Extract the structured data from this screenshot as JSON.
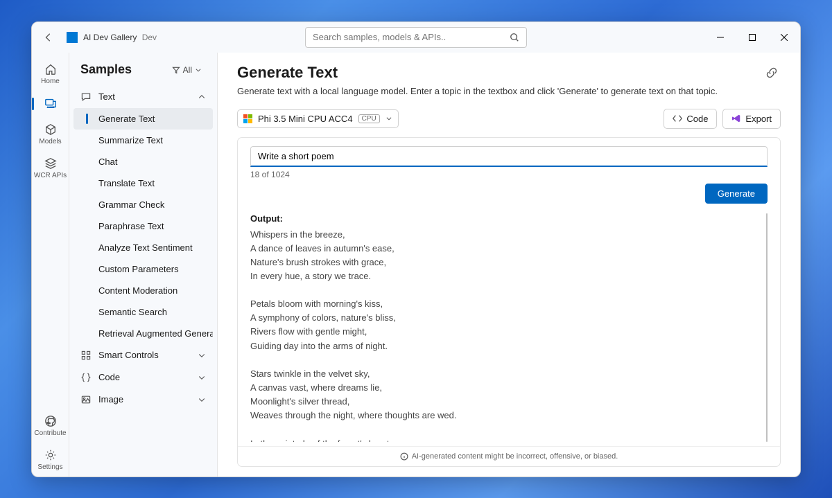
{
  "app": {
    "title": "AI Dev Gallery",
    "tag": "Dev"
  },
  "search": {
    "placeholder": "Search samples, models & APIs.."
  },
  "rail": {
    "home": "Home",
    "samples": "",
    "models": "Models",
    "wcr": "WCR APIs",
    "contribute": "Contribute",
    "settings": "Settings"
  },
  "sidebar": {
    "title": "Samples",
    "filter_label": "All",
    "categories": {
      "text": "Text",
      "smart": "Smart Controls",
      "code": "Code",
      "image": "Image"
    },
    "text_items": [
      "Generate Text",
      "Summarize Text",
      "Chat",
      "Translate Text",
      "Grammar Check",
      "Paraphrase Text",
      "Analyze Text Sentiment",
      "Custom Parameters",
      "Content Moderation",
      "Semantic Search",
      "Retrieval Augmented Genera"
    ]
  },
  "page": {
    "title": "Generate Text",
    "description": "Generate text with a local language model. Enter a topic in the textbox and click 'Generate' to generate text on that topic."
  },
  "model": {
    "name": "Phi 3.5 Mini CPU ACC4",
    "badge": "CPU"
  },
  "buttons": {
    "code": "Code",
    "export": "Export",
    "generate": "Generate"
  },
  "prompt": {
    "value": "Write a short poem",
    "count": "18 of 1024"
  },
  "output": {
    "label": "Output:",
    "text": "Whispers in the breeze,\nA dance of leaves in autumn's ease,\nNature's brush strokes with grace,\nIn every hue, a story we trace.\n\nPetals bloom with morning's kiss,\nA symphony of colors, nature's bliss,\nRivers flow with gentle might,\nGuiding day into the arms of night.\n\nStars twinkle in the velvet sky,\nA canvas vast, where dreams lie,\nMoonlight's silver thread,\nWeaves through the night, where thoughts are wed.\n\nIn the quietude of the forest's heart,\nEach beat, a poem, a work of art,\nLife's rhythm, a soft, sweet hum,"
  },
  "disclaimer": "AI-generated content might be incorrect, offensive, or biased."
}
